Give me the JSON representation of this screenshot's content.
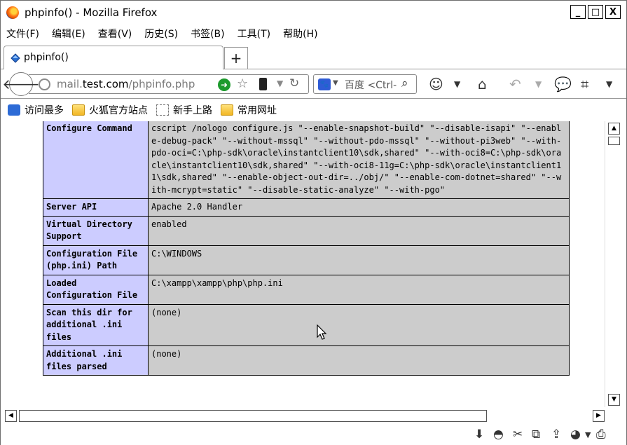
{
  "window": {
    "title": "phpinfo() - Mozilla Firefox",
    "controls": {
      "minimize": "_",
      "maximize": "□",
      "close": "X"
    }
  },
  "menu": [
    "文件(F)",
    "编辑(E)",
    "查看(V)",
    "历史(S)",
    "书签(B)",
    "工具(T)",
    "帮助(H)"
  ],
  "tab": {
    "title": "phpinfo()",
    "new_tab": "+"
  },
  "navbar": {
    "url_prefix": "mail.",
    "url_domain": "test.com",
    "url_path": "/phpinfo.php",
    "search_engine": "百度",
    "search_placeholder": "<Ctrl-"
  },
  "bookmarks": [
    {
      "label": "访问最多",
      "icon": "magnifier-icon"
    },
    {
      "label": "火狐官方站点",
      "icon": "folder-icon"
    },
    {
      "label": "新手上路",
      "icon": "dashed-page-icon"
    },
    {
      "label": "常用网址",
      "icon": "folder-icon"
    }
  ],
  "phpinfo": [
    {
      "key": "Configure Command",
      "value": "cscript /nologo configure.js \"--enable-snapshot-build\" \"--disable-isapi\" \"--enable-debug-pack\" \"--without-mssql\" \"--without-pdo-mssql\" \"--without-pi3web\" \"--with-pdo-oci=C:\\php-sdk\\oracle\\instantclient10\\sdk,shared\" \"--with-oci8=C:\\php-sdk\\oracle\\instantclient10\\sdk,shared\" \"--with-oci8-11g=C:\\php-sdk\\oracle\\instantclient11\\sdk,shared\" \"--enable-object-out-dir=../obj/\" \"--enable-com-dotnet=shared\" \"--with-mcrypt=static\" \"--disable-static-analyze\" \"--with-pgo\""
    },
    {
      "key": "Server API",
      "value": "Apache 2.0 Handler"
    },
    {
      "key": "Virtual Directory Support",
      "value": "enabled"
    },
    {
      "key": "Configuration File (php.ini) Path",
      "value": "C:\\WINDOWS"
    },
    {
      "key": "Loaded Configuration File",
      "value": "C:\\xampp\\xampp\\php\\php.ini"
    },
    {
      "key": "Scan this dir for additional .ini files",
      "value": "(none)"
    },
    {
      "key": "Additional .ini files parsed",
      "value": "(none)"
    }
  ],
  "colors": {
    "key_bg": "#ccccff",
    "value_bg": "#cccccc"
  }
}
